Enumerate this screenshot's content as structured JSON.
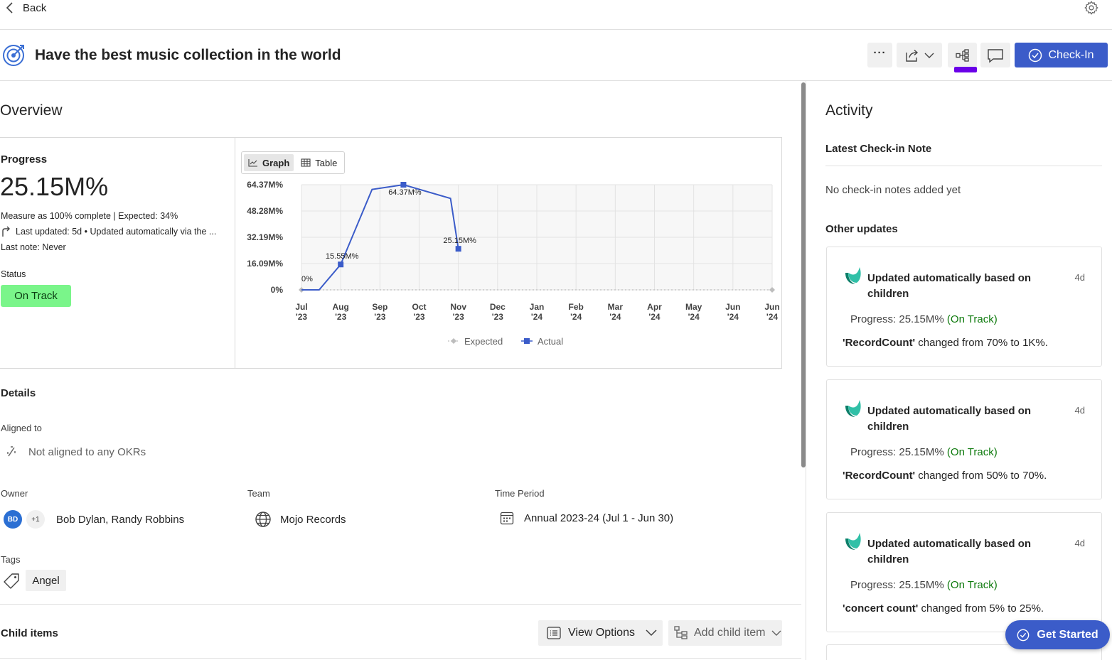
{
  "nav": {
    "back_label": "Back"
  },
  "header": {
    "title": "Have the best music collection in the world",
    "checkin_label": "Check-In",
    "more_label": "···"
  },
  "overview": {
    "title": "Overview",
    "progress_label": "Progress",
    "progress_value": "25.15M%",
    "measure_text": "Measure as 100% complete | Expected: 34%",
    "last_updated": "Last updated: 5d • Updated automatically via the ...",
    "last_note": "Last note: Never",
    "status_label": "Status",
    "status_value": "On Track",
    "view_toggle": {
      "graph": "Graph",
      "table": "Table"
    }
  },
  "chart_data": {
    "type": "line",
    "y_ticks": [
      "64.37M%",
      "48.28M%",
      "32.19M%",
      "16.09M%",
      "0%"
    ],
    "y_values_ticks": [
      64.37,
      48.28,
      32.19,
      16.09,
      0
    ],
    "ylim": [
      0,
      64.37
    ],
    "x_ticks": [
      [
        "Jul",
        "'23"
      ],
      [
        "Aug",
        "'23"
      ],
      [
        "Sep",
        "'23"
      ],
      [
        "Oct",
        "'23"
      ],
      [
        "Nov",
        "'23"
      ],
      [
        "Dec",
        "'23"
      ],
      [
        "Jan",
        "'24"
      ],
      [
        "Feb",
        "'24"
      ],
      [
        "Mar",
        "'24"
      ],
      [
        "Apr",
        "'24"
      ],
      [
        "May",
        "'24"
      ],
      [
        "Jun",
        "'24"
      ],
      [
        "Jun",
        "'24"
      ]
    ],
    "series": [
      {
        "name": "Actual",
        "color": "#3b5cc9",
        "points": [
          {
            "x": 0.0,
            "y": 0,
            "label": "0%",
            "marker": false
          },
          {
            "x": 0.45,
            "y": 0,
            "marker": false
          },
          {
            "x": 1.0,
            "y": 15.55,
            "label": "15.55M%",
            "marker": true
          },
          {
            "x": 1.8,
            "y": 61.5,
            "marker": false
          },
          {
            "x": 2.6,
            "y": 64.37,
            "label": "64.37M%",
            "marker": true
          },
          {
            "x": 3.8,
            "y": 56.0,
            "marker": false
          },
          {
            "x": 4.0,
            "y": 25.15,
            "label": "25.15M%",
            "marker": true
          }
        ]
      },
      {
        "name": "Expected",
        "color": "#bdbdbd",
        "points": [
          {
            "x": 0.0,
            "y": 0,
            "marker": true
          },
          {
            "x": 12.0,
            "y": 0,
            "marker": true
          }
        ]
      }
    ],
    "legend": [
      "Expected",
      "Actual"
    ],
    "grid": true
  },
  "details": {
    "title": "Details",
    "aligned_label": "Aligned to",
    "aligned_value": "Not aligned to any OKRs",
    "owner_label": "Owner",
    "owner_avatar": "BD",
    "owner_more": "+1",
    "owner_names": "Bob Dylan, Randy Robbins",
    "team_label": "Team",
    "team_value": "Mojo Records",
    "time_label": "Time Period",
    "time_value": "Annual 2023-24 (Jul 1 - Jun 30)",
    "tags_label": "Tags",
    "tag_value": "Angel"
  },
  "child_items": {
    "title": "Child items",
    "view_options": "View Options",
    "add_child": "Add child item"
  },
  "activity": {
    "title": "Activity",
    "latest_label": "Latest Check-in Note",
    "no_notes": "No check-in notes added yet",
    "other_label": "Other updates",
    "cards": [
      {
        "title": "Updated automatically based on children",
        "age": "4d",
        "progress": "Progress: 25.15M%",
        "status": "(On Track)",
        "field": "'RecordCount'",
        "change": " changed from 70% to 1K%."
      },
      {
        "title": "Updated automatically based on children",
        "age": "4d",
        "progress": "Progress: 25.15M%",
        "status": "(On Track)",
        "field": "'RecordCount'",
        "change": " changed from 50% to 70%."
      },
      {
        "title": "Updated automatically based on children",
        "age": "4d",
        "progress": "Progress: 25.15M%",
        "status": "(On Track)",
        "field": "'concert count'",
        "change": " changed from 5% to 25%."
      }
    ]
  },
  "get_started": "Get Started",
  "colors": {
    "accent": "#3b5cc9",
    "on_track": "#7af58a",
    "highlight": "#6a00e8"
  }
}
